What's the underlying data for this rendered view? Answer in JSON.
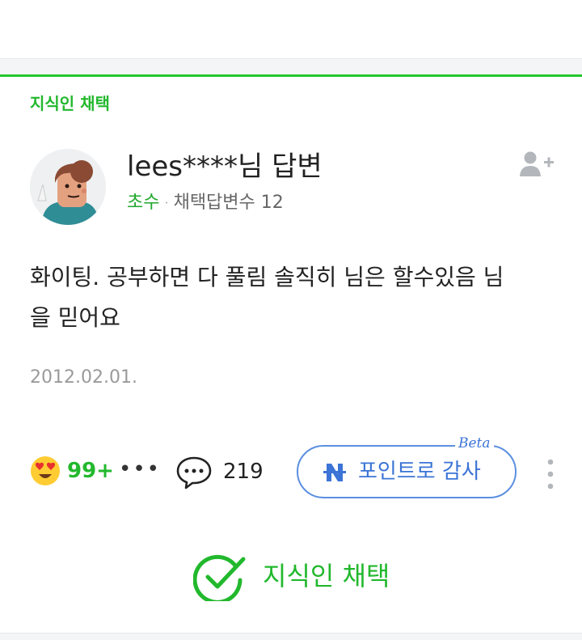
{
  "adoption": {
    "label": "지식인 채택"
  },
  "answer": {
    "author": "lees****님 답변",
    "grade": "초수",
    "adopted_label": "채택답변수",
    "adopted_count": "12",
    "content_line1": "화이팅. 공부하면 다 풀림 솔직히 님은 할수있음 님",
    "content_line2": "을 믿어요",
    "date": "2012.02.01."
  },
  "actions": {
    "reaction_count": "99+",
    "more_dots": "•••",
    "comment_count": "219",
    "thanks_label": "포인트로 감사",
    "beta_label": "Beta"
  },
  "footer": {
    "adopt_label": "지식인 채택"
  },
  "icons": {
    "reaction": "heart-eyes-emoji-icon",
    "comment": "speech-bubble-icon",
    "follow": "add-user-icon",
    "points": "naver-pay-icon",
    "more": "vertical-ellipsis-icon",
    "adopt": "check-circle-icon"
  },
  "colors": {
    "green": "#22b82d",
    "blue": "#3b74d6",
    "gray": "#9a9a9a"
  }
}
